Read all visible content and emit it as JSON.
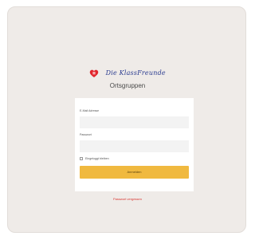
{
  "brand": {
    "logo_icon": "heart-icon",
    "logo_text": "Die KlassFreunde",
    "logo_color": "#2a3b8f",
    "accent_color": "#e1262d"
  },
  "page": {
    "subtitle": "Ortsgruppen"
  },
  "form": {
    "email_label": "E-Mail Adresse",
    "email_value": "",
    "password_label": "Passwort",
    "password_value": "",
    "remember_label": "Eingeloggt bleiben",
    "remember_checked": false,
    "submit_label": "Anmelden",
    "submit_color": "#f0b93f",
    "forgot_label": "Passwort vergessen"
  }
}
